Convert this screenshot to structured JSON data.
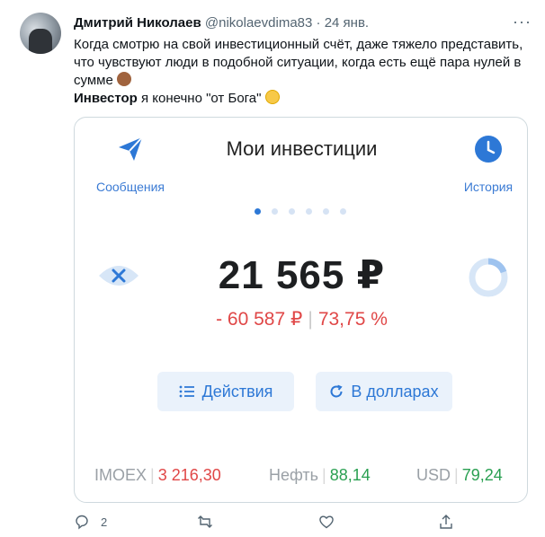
{
  "tweet": {
    "author_name": "Дмитрий Николаев",
    "handle": "@nikolaevdima83",
    "separator": "·",
    "date": "24 янв.",
    "text_line1": "Когда смотрю на свой инвестиционный счёт, даже тяжело представить,",
    "text_line2": "что чувствуют люди в подобной ситуации, когда есть ещё пара нулей в",
    "text_line3": "сумме",
    "bold_word": "Инвестор",
    "text_after_bold": " я конечно \"от Бога\"",
    "more_label": "···",
    "reply_count": "2",
    "retweet_count": "",
    "like_count": ""
  },
  "card": {
    "title": "Мои инвестиции",
    "messages_label": "Сообщения",
    "history_label": "История",
    "amount": "21 565 ₽",
    "loss_amount": "- 60 587 ₽",
    "loss_separator": "|",
    "loss_percent": "73,75 %",
    "actions_button": "Действия",
    "usd_button": "В долларах",
    "page_dots": 6,
    "active_dot": 0,
    "tickers": [
      {
        "name": "IMOEX",
        "value": "3 216,30",
        "trend": "down"
      },
      {
        "name": "Нефть",
        "value": "88,14",
        "trend": "up"
      },
      {
        "name": "USD",
        "value": "79,24",
        "trend": "up"
      }
    ]
  },
  "icons": {
    "messages": "send-icon",
    "history": "clock-icon",
    "hide": "eye-hidden-icon",
    "portfolio": "donut-icon",
    "actions": "list-icon",
    "currency": "refresh-icon",
    "reply": "reply-icon",
    "retweet": "retweet-icon",
    "like": "heart-icon",
    "share": "share-icon"
  },
  "colors": {
    "accent": "#2d78d6",
    "loss": "#e04747",
    "gain": "#2aa052",
    "muted": "#536471"
  }
}
